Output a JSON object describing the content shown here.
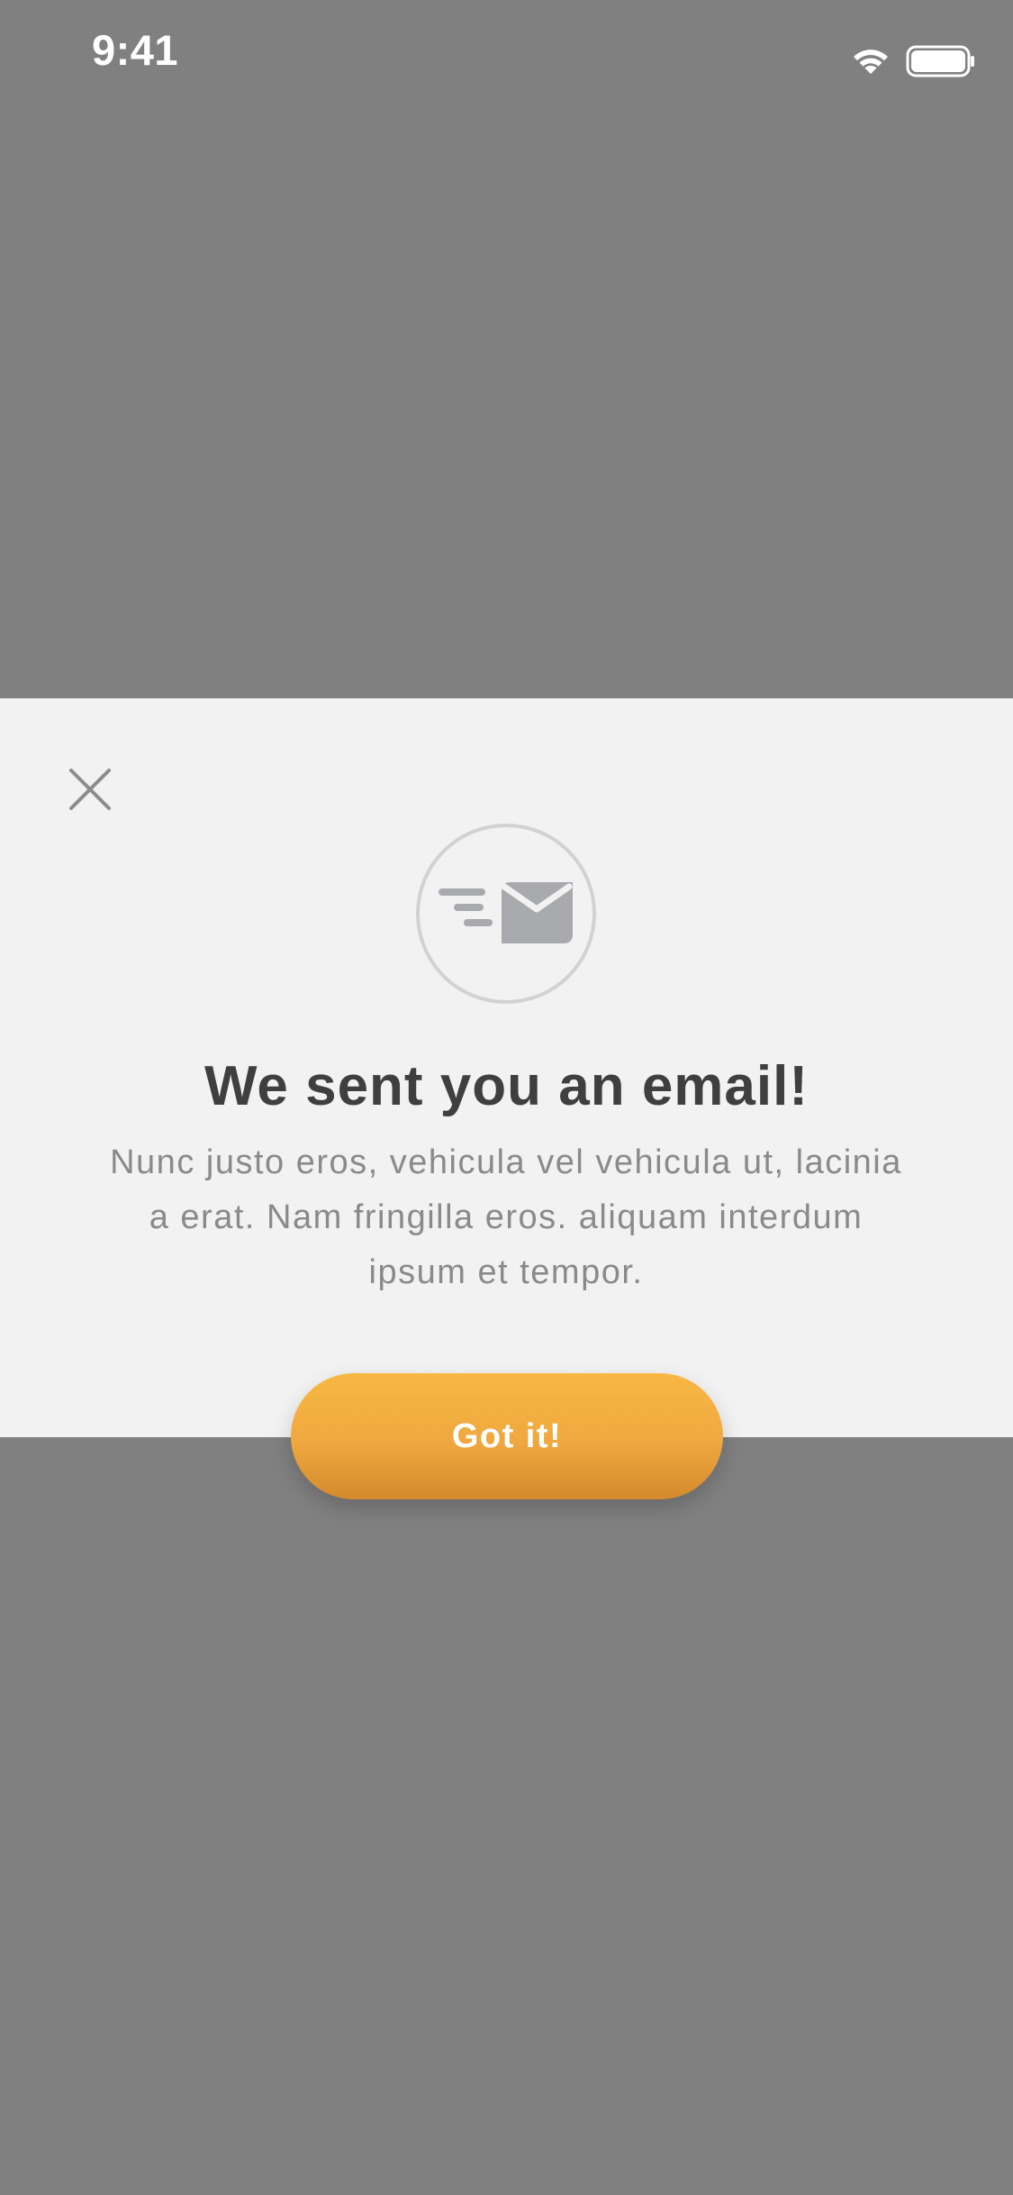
{
  "status_bar": {
    "time": "9:41",
    "wifi_icon": "wifi-icon",
    "battery_icon": "battery-icon"
  },
  "modal": {
    "close_icon": "close-icon",
    "email_icon": "email-sent-icon",
    "title": "We sent you an email!",
    "body": "Nunc justo eros, vehicula vel vehicula ut, lacinia a erat. Nam fringilla eros. aliquam interdum ipsum et tempor.",
    "button_label": "Got it!"
  },
  "colors": {
    "overlay": "#808080",
    "modal_background": "#f2f2f2",
    "title": "#3f3f3f",
    "body_text": "#8a8a8a",
    "button_top": "#f8b843",
    "button_bottom": "#d48a2d",
    "icon_gray": "#a9aaae"
  }
}
